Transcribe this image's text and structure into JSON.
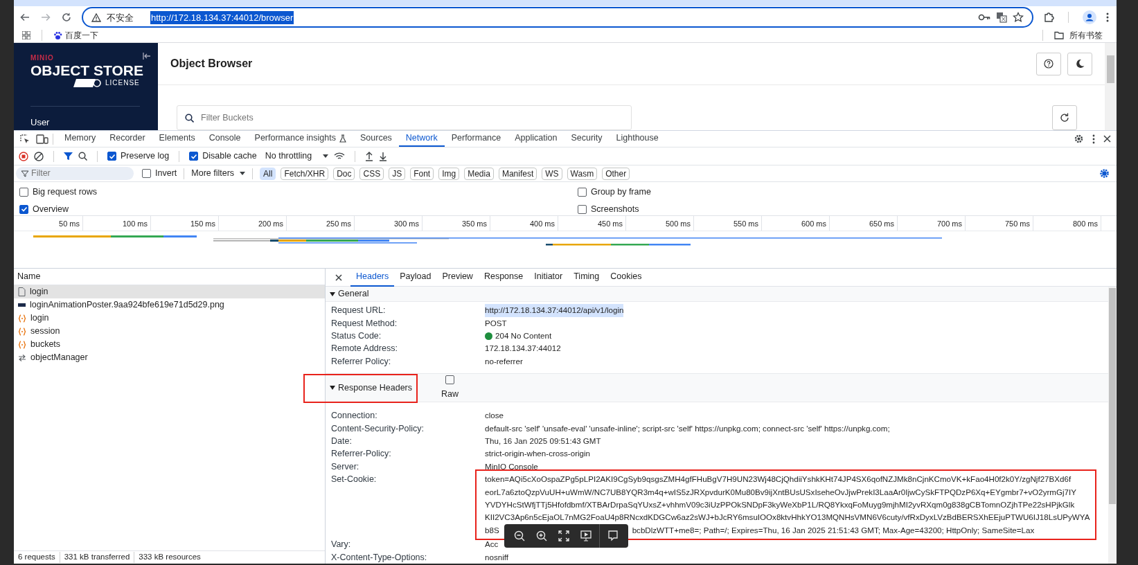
{
  "browser": {
    "security_label": "不安全",
    "url": "http://172.18.134.37:44012/browser",
    "url_selected": true,
    "bookmarks": [
      {
        "label": "百度一下"
      }
    ],
    "bookmarks_folder": "所有书签"
  },
  "app": {
    "brand_top": "MINIO",
    "brand_main": "OBJECT STORE",
    "license": "LICENSE",
    "sidebar_item": "User",
    "page_title": "Object Browser",
    "filter_placeholder": "Filter Buckets"
  },
  "devtools": {
    "tabs": [
      {
        "label": "Memory",
        "selected": false
      },
      {
        "label": "Recorder",
        "selected": false
      },
      {
        "label": "Elements",
        "selected": false
      },
      {
        "label": "Console",
        "selected": false
      },
      {
        "label": "Performance insights",
        "selected": false,
        "kind": "flask"
      },
      {
        "label": "Sources",
        "selected": false
      },
      {
        "label": "Network",
        "selected": true
      },
      {
        "label": "Performance",
        "selected": false
      },
      {
        "label": "Application",
        "selected": false
      },
      {
        "label": "Security",
        "selected": false
      },
      {
        "label": "Lighthouse",
        "selected": false
      }
    ],
    "toolbar": {
      "recording": true,
      "preserve_log": {
        "label": "Preserve log",
        "checked": true
      },
      "disable_cache": {
        "label": "Disable cache",
        "checked": true
      },
      "throttling": "No throttling"
    },
    "filter": {
      "placeholder": "Filter",
      "invert": {
        "label": "Invert",
        "checked": false
      },
      "more_filters": "More filters",
      "types": [
        {
          "label": "All",
          "selected": true
        },
        {
          "label": "Fetch/XHR",
          "selected": false
        },
        {
          "label": "Doc",
          "selected": false
        },
        {
          "label": "CSS",
          "selected": false
        },
        {
          "label": "JS",
          "selected": false
        },
        {
          "label": "Font",
          "selected": false
        },
        {
          "label": "Img",
          "selected": false
        },
        {
          "label": "Media",
          "selected": false
        },
        {
          "label": "Manifest",
          "selected": false
        },
        {
          "label": "WS",
          "selected": false
        },
        {
          "label": "Wasm",
          "selected": false
        },
        {
          "label": "Other",
          "selected": false
        }
      ]
    },
    "options": [
      {
        "label": "Big request rows",
        "checked": false
      },
      {
        "label": "Group by frame",
        "checked": false
      },
      {
        "label": "Overview",
        "checked": true
      },
      {
        "label": "Screenshots",
        "checked": false
      }
    ],
    "timeline_ticks": [
      "50 ms",
      "100 ms",
      "150 ms",
      "200 ms",
      "250 ms",
      "300 ms",
      "350 ms",
      "400 ms",
      "450 ms",
      "500 ms",
      "550 ms",
      "600 ms",
      "650 ms",
      "700 ms",
      "750 ms",
      "800 ms"
    ],
    "name_header": "Name",
    "requests": [
      {
        "name": "login",
        "kind": "document",
        "selected": true
      },
      {
        "name": "loginAnimationPoster.9aa924bfe619e71d5d29.png",
        "kind": "image",
        "selected": false
      },
      {
        "name": "login",
        "kind": "fetch",
        "selected": false
      },
      {
        "name": "session",
        "kind": "fetch",
        "selected": false
      },
      {
        "name": "buckets",
        "kind": "fetch",
        "selected": false
      },
      {
        "name": "objectManager",
        "kind": "websocket",
        "selected": false
      }
    ],
    "status_bar": [
      "6 requests",
      "331 kB transferred",
      "333 kB resources"
    ],
    "detail_tabs": [
      {
        "label": "Headers",
        "selected": true
      },
      {
        "label": "Payload",
        "selected": false
      },
      {
        "label": "Preview",
        "selected": false
      },
      {
        "label": "Response",
        "selected": false
      },
      {
        "label": "Initiator",
        "selected": false
      },
      {
        "label": "Timing",
        "selected": false
      },
      {
        "label": "Cookies",
        "selected": false
      }
    ],
    "general": {
      "title": "General",
      "expanded": true,
      "rows": [
        {
          "name": "Request URL:",
          "value": "http://172.18.134.37:44012/api/v1/login",
          "highlighted": true
        },
        {
          "name": "Request Method:",
          "value": "POST",
          "highlighted": false
        },
        {
          "name": "Status Code:",
          "value": "204 No Content",
          "highlighted": false,
          "color": "#1e8e3e"
        },
        {
          "name": "Remote Address:",
          "value": "172.18.134.37:44012",
          "highlighted": false
        },
        {
          "name": "Referrer Policy:",
          "value": "no-referrer",
          "highlighted": false
        }
      ]
    },
    "response_headers": {
      "title": "Response Headers",
      "expanded": true,
      "raw": {
        "label": "Raw",
        "checked": false
      },
      "rows": [
        {
          "name": "Connection:",
          "lines": [
            [
              "close"
            ]
          ]
        },
        {
          "name": "Content-Security-Policy:",
          "lines": [
            [
              "default-src 'self' 'unsafe-eval' 'unsafe-inline'; script-src 'self' https://unpkg.com; connect-src 'self' https://unpkg.com;"
            ]
          ]
        },
        {
          "name": "Date:",
          "lines": [
            [
              "Thu, 16 Jan 2025 09:51:43 GMT"
            ]
          ]
        },
        {
          "name": "Referrer-Policy:",
          "lines": [
            [
              "strict-origin-when-cross-origin"
            ]
          ]
        },
        {
          "name": "Server:",
          "lines": [
            [
              "MinIO Console"
            ]
          ]
        },
        {
          "name": "Set-Cookie:",
          "lines": [
            [
              "token=AQi5cXoOspaZPg5pLPI2AKI9CgSyb9qsgsZMH4gfFHuBgV7H9UN23Wj48CjQhdiiYshkKHt74JP4SX6qofNZJMk8nCjnKCmoVK+kFao4H0f2k0Y/zgNjf27BXd6f"
            ],
            [
              "eorL7a6ztoQzpVuUH+uWmW/NC7UB8YQR3m4q+wIS5zJRXpvdurK0Mu80Bv9ijXntBUsUSxIseheOvJjwPrekI3LaaAr0IjwCySkFTPQDzP6Xq+EYgmbr7+vO2yrmGj7IY"
            ],
            [
              "YVDYHcStWfjTTj5Hfofdbmf/XTBArDrpaSqYUxsZ+vhhmV09c3iUzPPOkSNDpF3kyWeXbP1L/RQ8YkxqFoMuyg9mjhMI2yvRXqm0g838gCBTomnOZjhTPe22sHPjkGlk"
            ],
            [
              "KII2VC3Ap6n5cEjaOL7nMG2FoaU4p8RNcxdKDGCw6az2sWJ+bJcRY6msuIOOx8ktvHhkYO13MQNHsVMN6V6cuty/vfRxDyxLVzBdBERSXhEEjuPTWU6IJ18LsUPyWYA"
            ],
            [
              "b8S",
              "bcbDlzWTT+me8=; Path=/; Expires=Thu, 16 Jan 2025 21:51:43 GMT; Max-Age=43200; HttpOnly; SameSite=Lax"
            ]
          ],
          "highlighted": true
        },
        {
          "name": "Vary:",
          "lines": [
            [
              "Acc"
            ]
          ]
        },
        {
          "name": "X-Content-Type-Options:",
          "lines": [
            [
              "nosniff"
            ]
          ]
        }
      ]
    }
  }
}
